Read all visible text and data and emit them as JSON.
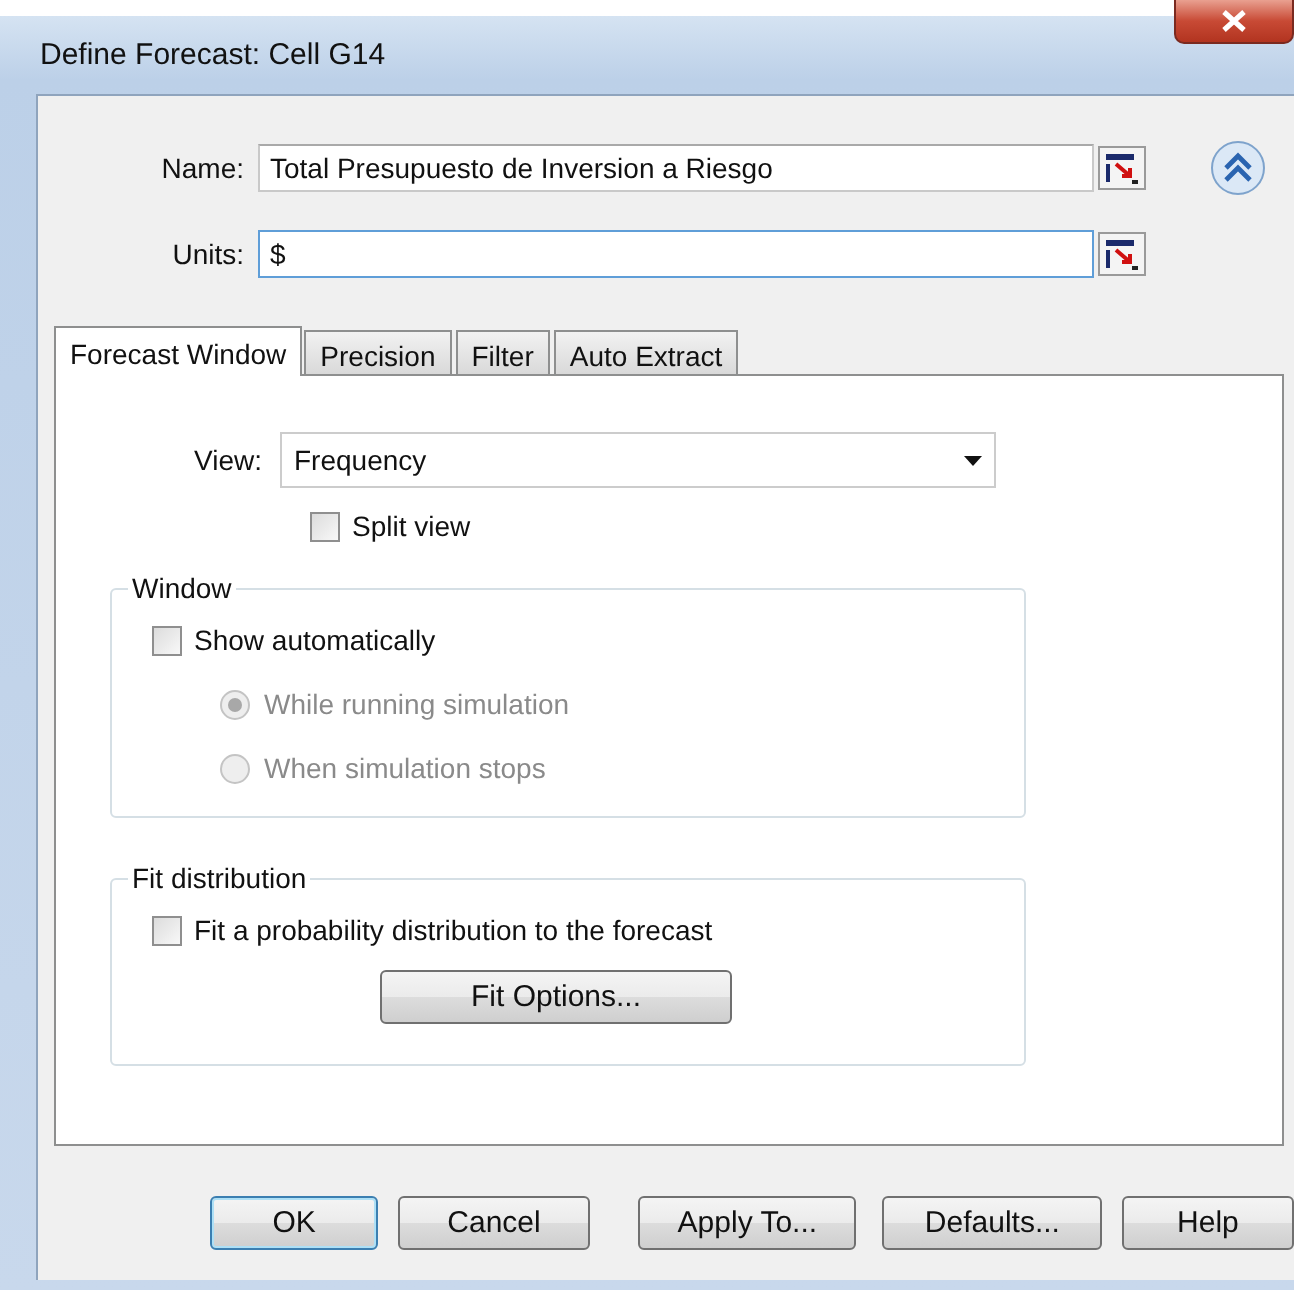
{
  "window": {
    "title": "Define Forecast: Cell G14"
  },
  "fields": [
    {
      "label": "Name:",
      "value": "Total Presupuesto de Inversion a Riesgo",
      "focused": false
    },
    {
      "label": "Units:",
      "value": "$",
      "focused": true
    }
  ],
  "tabs": [
    {
      "label": "Forecast Window",
      "selected": true
    },
    {
      "label": "Precision",
      "selected": false
    },
    {
      "label": "Filter",
      "selected": false
    },
    {
      "label": "Auto Extract",
      "selected": false
    }
  ],
  "view": {
    "label": "View:",
    "value": "Frequency"
  },
  "split_view": {
    "label": "Split view",
    "checked": false
  },
  "window_group": {
    "title": "Window",
    "show_automatically": {
      "label": "Show automatically",
      "checked": false
    },
    "options": [
      {
        "label": "While running simulation",
        "selected": true,
        "disabled": true
      },
      {
        "label": "When simulation stops",
        "selected": false,
        "disabled": true
      }
    ]
  },
  "fit_group": {
    "title": "Fit distribution",
    "checkbox": {
      "label": "Fit a probability distribution to the forecast",
      "checked": false
    },
    "button": "Fit Options..."
  },
  "buttons": [
    {
      "label": "OK",
      "default": true
    },
    {
      "label": "Cancel",
      "default": false
    },
    {
      "label": "Apply To...",
      "default": false
    },
    {
      "label": "Defaults...",
      "default": false
    },
    {
      "label": "Help",
      "default": false
    }
  ]
}
